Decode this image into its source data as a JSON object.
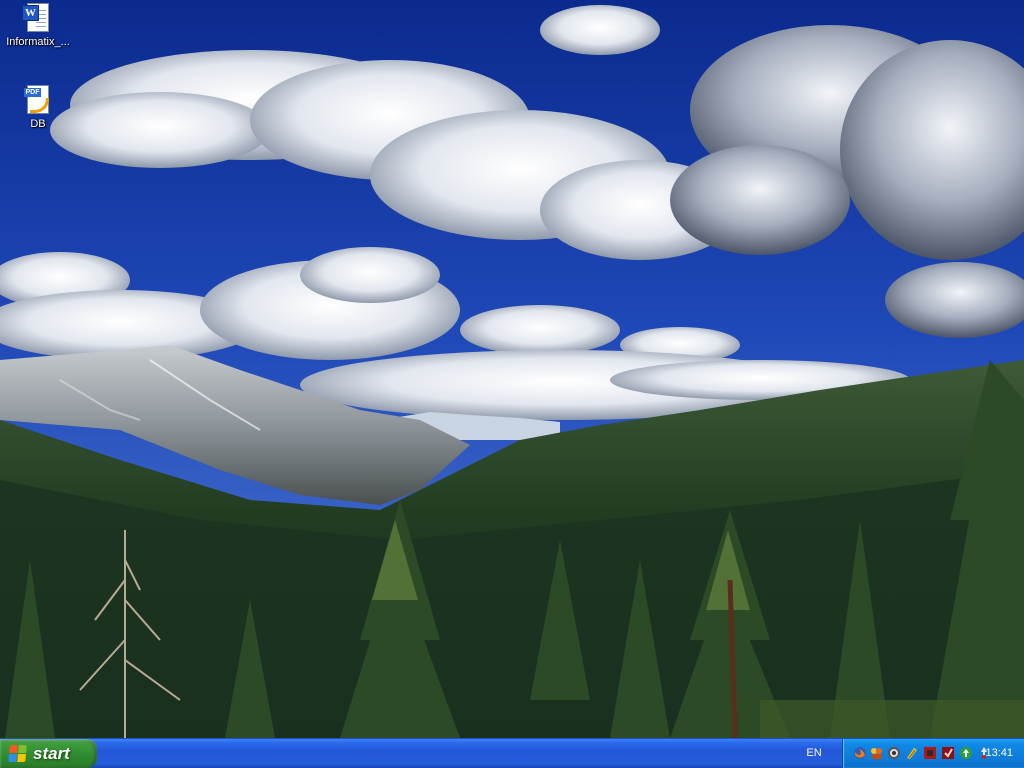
{
  "desktop": {
    "icons": [
      {
        "label": "Informatix_...",
        "icon": "word-document-icon"
      },
      {
        "label": "DB",
        "icon": "pdf-document-icon"
      }
    ],
    "wallpaper": "mountain-forest-landscape"
  },
  "taskbar": {
    "start_label": "start",
    "language": "EN",
    "tray_icons": [
      "firefox-icon",
      "messenger-icon",
      "network-icon",
      "power-icon",
      "security-shield-icon",
      "antivirus-icon",
      "update-icon",
      "safely-remove-icon"
    ],
    "clock": "13:41"
  },
  "colors": {
    "taskbar": "#245edc",
    "start_button": "#3c9a3c",
    "tray": "#0d7ad7"
  }
}
